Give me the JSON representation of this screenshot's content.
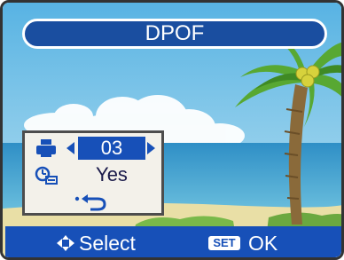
{
  "header": {
    "title": "DPOF"
  },
  "settings": {
    "copies": {
      "icon": "printer-icon",
      "value": "03"
    },
    "date_imprint": {
      "icon": "date-icon",
      "value": "Yes"
    },
    "back": {
      "icon": "back-return-icon"
    }
  },
  "footer": {
    "nav_icon": "four-way-arrow-icon",
    "select_label": "Select",
    "set_label": "SET",
    "ok_label": "OK"
  },
  "colors": {
    "bar_blue": "#1750b8",
    "sky": "#86c8e8",
    "sea": "#3a98c8",
    "sand": "#e9dfa6",
    "panel": "#f3f1ea"
  }
}
